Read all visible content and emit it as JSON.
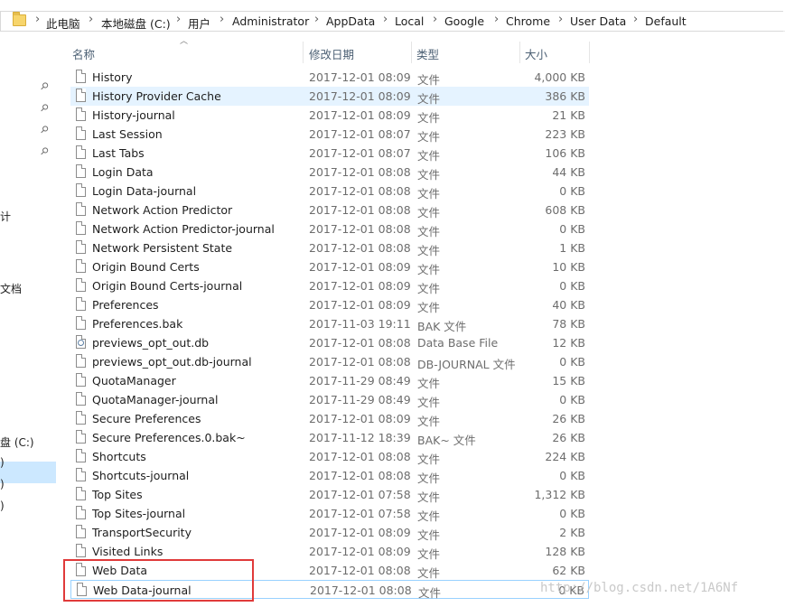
{
  "breadcrumb": [
    "此电脑",
    "本地磁盘 (C:)",
    "用户",
    "Administrator",
    "AppData",
    "Local",
    "Google",
    "Chrome",
    "User Data",
    "Default"
  ],
  "breadcrumb_separator": "›",
  "nav": {
    "fragments": [
      "计",
      "文档",
      "盘 (C:)",
      ")",
      ")",
      ")"
    ],
    "pin_icon": "pin-icon"
  },
  "columns": {
    "name": "名称",
    "date": "修改日期",
    "type": "类型",
    "size": "大小"
  },
  "files": [
    {
      "name": "History",
      "date": "2017-12-01 08:09",
      "type": "文件",
      "size": "4,000 KB",
      "icon": "file"
    },
    {
      "name": "History Provider Cache",
      "date": "2017-12-01 08:09",
      "type": "文件",
      "size": "386 KB",
      "icon": "file"
    },
    {
      "name": "History-journal",
      "date": "2017-12-01 08:09",
      "type": "文件",
      "size": "21 KB",
      "icon": "file"
    },
    {
      "name": "Last Session",
      "date": "2017-12-01 08:07",
      "type": "文件",
      "size": "223 KB",
      "icon": "file"
    },
    {
      "name": "Last Tabs",
      "date": "2017-12-01 08:07",
      "type": "文件",
      "size": "106 KB",
      "icon": "file"
    },
    {
      "name": "Login Data",
      "date": "2017-12-01 08:08",
      "type": "文件",
      "size": "44 KB",
      "icon": "file"
    },
    {
      "name": "Login Data-journal",
      "date": "2017-12-01 08:08",
      "type": "文件",
      "size": "0 KB",
      "icon": "file"
    },
    {
      "name": "Network Action Predictor",
      "date": "2017-12-01 08:08",
      "type": "文件",
      "size": "608 KB",
      "icon": "file"
    },
    {
      "name": "Network Action Predictor-journal",
      "date": "2017-12-01 08:08",
      "type": "文件",
      "size": "0 KB",
      "icon": "file"
    },
    {
      "name": "Network Persistent State",
      "date": "2017-12-01 08:08",
      "type": "文件",
      "size": "1 KB",
      "icon": "file"
    },
    {
      "name": "Origin Bound Certs",
      "date": "2017-12-01 08:09",
      "type": "文件",
      "size": "10 KB",
      "icon": "file"
    },
    {
      "name": "Origin Bound Certs-journal",
      "date": "2017-12-01 08:09",
      "type": "文件",
      "size": "0 KB",
      "icon": "file"
    },
    {
      "name": "Preferences",
      "date": "2017-12-01 08:09",
      "type": "文件",
      "size": "40 KB",
      "icon": "file"
    },
    {
      "name": "Preferences.bak",
      "date": "2017-11-03 19:11",
      "type": "BAK 文件",
      "size": "78 KB",
      "icon": "file"
    },
    {
      "name": "previews_opt_out.db",
      "date": "2017-12-01 08:08",
      "type": "Data Base File",
      "size": "12 KB",
      "icon": "db"
    },
    {
      "name": "previews_opt_out.db-journal",
      "date": "2017-12-01 08:08",
      "type": "DB-JOURNAL 文件",
      "size": "0 KB",
      "icon": "file"
    },
    {
      "name": "QuotaManager",
      "date": "2017-11-29 08:49",
      "type": "文件",
      "size": "15 KB",
      "icon": "file"
    },
    {
      "name": "QuotaManager-journal",
      "date": "2017-11-29 08:49",
      "type": "文件",
      "size": "0 KB",
      "icon": "file"
    },
    {
      "name": "Secure Preferences",
      "date": "2017-12-01 08:09",
      "type": "文件",
      "size": "26 KB",
      "icon": "file"
    },
    {
      "name": "Secure Preferences.0.bak~",
      "date": "2017-11-12 18:39",
      "type": "BAK~ 文件",
      "size": "26 KB",
      "icon": "file"
    },
    {
      "name": "Shortcuts",
      "date": "2017-12-01 08:08",
      "type": "文件",
      "size": "224 KB",
      "icon": "file"
    },
    {
      "name": "Shortcuts-journal",
      "date": "2017-12-01 08:08",
      "type": "文件",
      "size": "0 KB",
      "icon": "file"
    },
    {
      "name": "Top Sites",
      "date": "2017-12-01 07:58",
      "type": "文件",
      "size": "1,312 KB",
      "icon": "file"
    },
    {
      "name": "Top Sites-journal",
      "date": "2017-12-01 07:58",
      "type": "文件",
      "size": "0 KB",
      "icon": "file"
    },
    {
      "name": "TransportSecurity",
      "date": "2017-12-01 08:09",
      "type": "文件",
      "size": "2 KB",
      "icon": "file"
    },
    {
      "name": "Visited Links",
      "date": "2017-12-01 08:09",
      "type": "文件",
      "size": "128 KB",
      "icon": "file"
    },
    {
      "name": "Web Data",
      "date": "2017-12-01 08:08",
      "type": "文件",
      "size": "62 KB",
      "icon": "file"
    },
    {
      "name": "Web Data-journal",
      "date": "2017-12-01 08:08",
      "type": "文件",
      "size": "0 KB",
      "icon": "file"
    }
  ],
  "hover_row": "History Provider Cache",
  "focused_row": "Web Data-journal",
  "watermark": "http://blog.csdn.net/1A6Nf",
  "colors": {
    "hover": "#e5f3ff",
    "nav_selected": "#cce8ff",
    "highlight_box": "#e03a3a"
  }
}
